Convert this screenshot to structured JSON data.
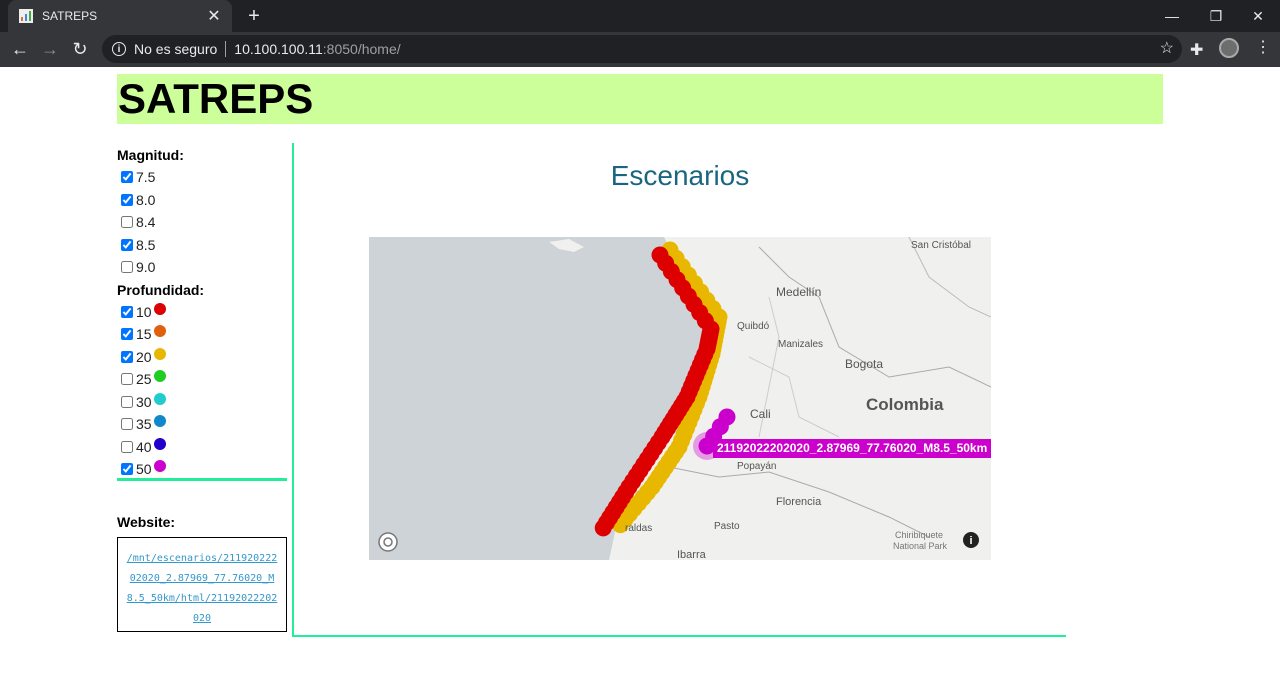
{
  "browser": {
    "tab_title": "SATREPS",
    "security_label": "No es seguro",
    "url_host": "10.100.100.11",
    "url_rest": ":8050/home/"
  },
  "header": {
    "title": "SATREPS"
  },
  "sidebar": {
    "magnitud_label": "Magnitud:",
    "magnitudes": [
      {
        "label": "7.5",
        "checked": true
      },
      {
        "label": "8.0",
        "checked": true
      },
      {
        "label": "8.4",
        "checked": false
      },
      {
        "label": "8.5",
        "checked": true
      },
      {
        "label": "9.0",
        "checked": false
      }
    ],
    "profundidad_label": "Profundidad:",
    "depths": [
      {
        "label": "10",
        "checked": true,
        "color": "#dd0000"
      },
      {
        "label": "15",
        "checked": true,
        "color": "#e06010"
      },
      {
        "label": "20",
        "checked": true,
        "color": "#e8b800"
      },
      {
        "label": "25",
        "checked": false,
        "color": "#22cc22"
      },
      {
        "label": "30",
        "checked": false,
        "color": "#22cccc"
      },
      {
        "label": "35",
        "checked": false,
        "color": "#1188cc"
      },
      {
        "label": "40",
        "checked": false,
        "color": "#2200cc"
      },
      {
        "label": "50",
        "checked": true,
        "color": "#cc00cc"
      }
    ],
    "website_label": "Website:",
    "website_link": "/mnt/escenarios/21192022202020_2.87969_77.76020_M8.5_50km/html/21192022202020"
  },
  "main": {
    "title": "Escenarios",
    "tooltip": "21192022202020_2.87969_77.76020_M8.5_50km",
    "map_labels": {
      "san_cristobal": "San Cristóbal",
      "medellin": "Medellín",
      "quibdo": "Quibdó",
      "manizales": "Manizales",
      "bogota": "Bogota",
      "colombia": "Colombia",
      "cali": "Cali",
      "popayan": "Popayán",
      "florencia": "Florencia",
      "pasto": "Pasto",
      "ibarra": "Ibarra",
      "esmeraldas": "raldas",
      "chiribiquete_1": "Chiribiquete",
      "chiribiquete_2": "National Park"
    }
  }
}
